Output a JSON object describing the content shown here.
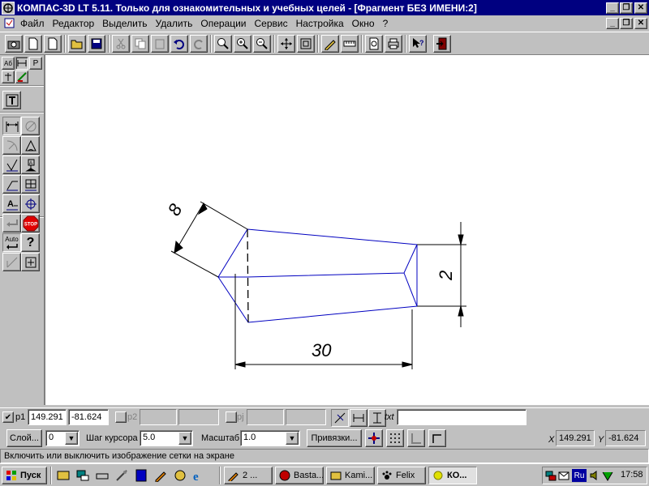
{
  "window": {
    "title": "КОМПАС-3D LT 5.11. Только для ознакомительных и учебных целей - [Фрагмент БЕЗ ИМЕНИ:2]",
    "controls": [
      "_",
      "❐",
      "✕"
    ]
  },
  "menu": [
    "Файл",
    "Редактор",
    "Выделить",
    "Удалить",
    "Операции",
    "Сервис",
    "Настройка",
    "Окно",
    "?"
  ],
  "drawing": {
    "dimension_top_left": "8",
    "dimension_right": "2",
    "dimension_bottom": "30"
  },
  "left_panel": {
    "tabs": [
      "Аб",
      "P"
    ],
    "stop_label": "STOP",
    "auto_label": "Auto",
    "help_label": "?"
  },
  "coords_bar": {
    "p1_label": "p1",
    "p1_x": "149.291",
    "p1_y": "-81.624",
    "p2_label": "p2",
    "pj_label": "pj",
    "txt_label": "txt"
  },
  "params_bar": {
    "layer_button": "Слой...",
    "layer_value": "0",
    "step_label": "Шаг курсора",
    "step_value": "5.0",
    "scale_label": "Масштаб",
    "scale_value": "1.0",
    "snap_button": "Привязки...",
    "x_label": "X",
    "x_value": "149.291",
    "y_label": "Y",
    "y_value": "-81.624"
  },
  "status": {
    "hint": "Включить или выключить изображение сетки на экране"
  },
  "taskbar": {
    "start_label": "Пуск",
    "tasks": [
      "2 ...",
      "Basta...",
      "Kami...",
      "Felix",
      "КО..."
    ],
    "lang": "Ru",
    "clock": "17:58"
  },
  "colors": {
    "title_bg": "#000080",
    "face": "#c0c0c0",
    "geometry_line": "#0000c0",
    "dimension_line": "#000000"
  }
}
